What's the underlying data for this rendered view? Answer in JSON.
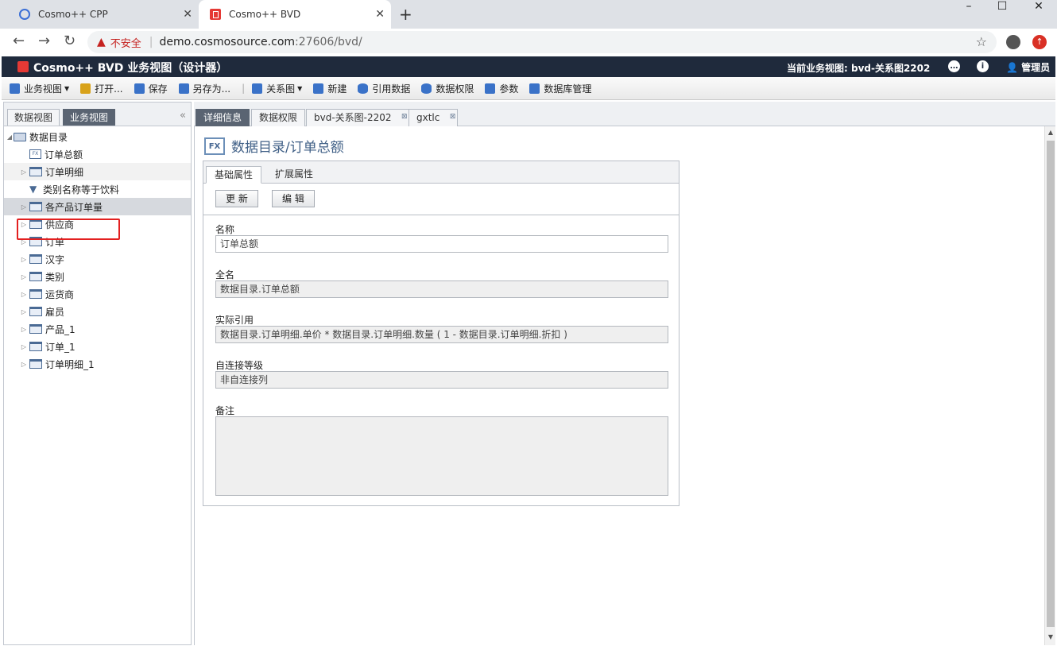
{
  "browser": {
    "tabs": [
      {
        "title": "Cosmo++ CPP",
        "active": false
      },
      {
        "title": "Cosmo++ BVD",
        "active": true
      }
    ],
    "new_tab": "+",
    "url": {
      "security_label": "不安全",
      "host": "demo.cosmosource.com",
      "rest": ":27606/bvd/"
    },
    "window_controls": {
      "minimize": "–",
      "maximize": "☐",
      "close": "✕"
    }
  },
  "app": {
    "title": "Cosmo++ BVD 业务视图（设计器）",
    "current_view": "当前业务视图: bvd-关系图2202",
    "user": "管理员",
    "header_icons": [
      "chat-icon",
      "info-icon",
      "user-icon"
    ]
  },
  "toolbar": {
    "items": [
      {
        "label": "业务视图",
        "icon": "view-icon",
        "dropdown": true
      },
      {
        "label": "打开...",
        "icon": "open-icon",
        "dropdown": false
      },
      {
        "label": "保存",
        "icon": "save-icon",
        "dropdown": false
      },
      {
        "label": "另存为...",
        "icon": "save-as-icon",
        "dropdown": false
      },
      {
        "label": "关系图",
        "icon": "relation-icon",
        "dropdown": true
      },
      {
        "label": "新建",
        "icon": "new-icon",
        "dropdown": false
      },
      {
        "label": "引用数据",
        "icon": "database-icon",
        "dropdown": false
      },
      {
        "label": "数据权限",
        "icon": "database-icon",
        "dropdown": false
      },
      {
        "label": "参数",
        "icon": "param-icon",
        "dropdown": false
      },
      {
        "label": "数据库管理",
        "icon": "db-manage-icon",
        "dropdown": false
      }
    ]
  },
  "left_panel": {
    "tabs": [
      {
        "label": "数据视图",
        "active": false
      },
      {
        "label": "业务视图",
        "active": true
      }
    ],
    "tree": {
      "root": "数据目录",
      "children": [
        {
          "label": "订单总额",
          "type": "formula",
          "expandable": false
        },
        {
          "label": "订单明细",
          "type": "table",
          "expandable": true
        },
        {
          "label": "类别名称等于饮料",
          "type": "filter",
          "expandable": false
        },
        {
          "label": "各产品订单量",
          "type": "table",
          "expandable": true,
          "highlighted": true
        },
        {
          "label": "供应商",
          "type": "table",
          "expandable": true
        },
        {
          "label": "订单",
          "type": "table",
          "expandable": true
        },
        {
          "label": "汉字",
          "type": "table",
          "expandable": true
        },
        {
          "label": "类别",
          "type": "table",
          "expandable": true
        },
        {
          "label": "运货商",
          "type": "table",
          "expandable": true
        },
        {
          "label": "雇员",
          "type": "table",
          "expandable": true
        },
        {
          "label": "产品_1",
          "type": "table",
          "expandable": true
        },
        {
          "label": "订单_1",
          "type": "table",
          "expandable": true
        },
        {
          "label": "订单明细_1",
          "type": "table",
          "expandable": true
        }
      ]
    }
  },
  "main": {
    "tabs": [
      {
        "label": "详细信息",
        "active": true,
        "closable": false
      },
      {
        "label": "数据权限",
        "active": false,
        "closable": false
      },
      {
        "label": "bvd-关系图-2202",
        "active": false,
        "closable": true
      },
      {
        "label": "gxtlc",
        "active": false,
        "closable": true
      }
    ],
    "page_title": "数据目录/订单总额",
    "detail_tabs": [
      {
        "label": "基础属性",
        "active": true
      },
      {
        "label": "扩展属性",
        "active": false
      }
    ],
    "buttons": {
      "update": "更 新",
      "edit": "编 辑"
    },
    "fields": {
      "name": {
        "label": "名称",
        "value": "订单总额"
      },
      "fullname": {
        "label": "全名",
        "value": "数据目录.订单总额"
      },
      "reference": {
        "label": "实际引用",
        "value": "数据目录.订单明细.单价 * 数据目录.订单明细.数量 ( 1 - 数据目录.订单明细.折扣 )"
      },
      "self_join": {
        "label": "自连接等级",
        "value": "非自连接列"
      },
      "remark": {
        "label": "备注",
        "value": ""
      }
    }
  }
}
